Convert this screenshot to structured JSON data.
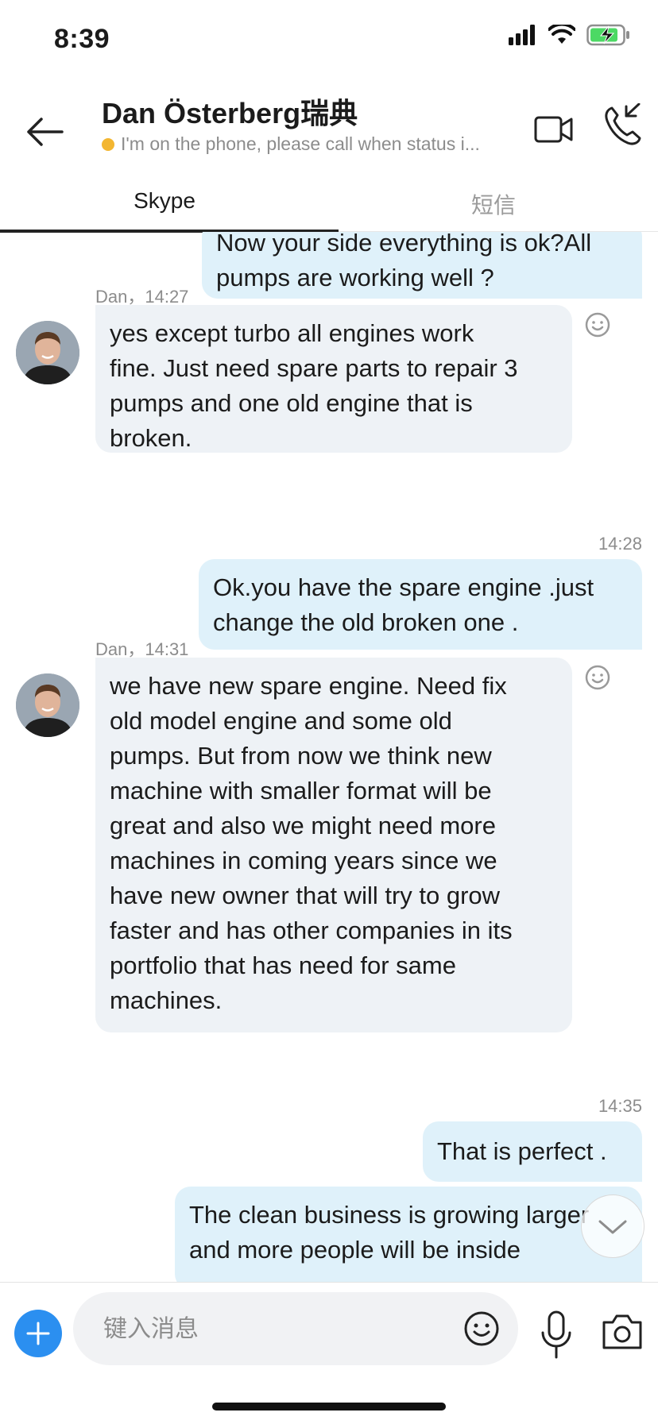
{
  "status_bar": {
    "time": "8:39"
  },
  "header": {
    "contact_name": "Dan Österberg瑞典",
    "contact_status": "I'm on the phone, please call when status i..."
  },
  "tabs": [
    {
      "label": "Skype",
      "active": true
    },
    {
      "label": "短信",
      "active": false
    }
  ],
  "messages": [
    {
      "direction": "out",
      "text_lines": [
        "Now your side everything is ok?All",
        "pumps are working well ?"
      ]
    },
    {
      "direction": "in",
      "sender_time": "Dan，14:27",
      "text_lines": [
        "yes except turbo all engines work",
        "fine. Just need spare parts to repair 3",
        "pumps and one old engine that is",
        "broken."
      ]
    },
    {
      "direction": "out",
      "time": "14:28",
      "text_lines": [
        "Ok.you have the spare engine .just",
        "change the old broken one ."
      ]
    },
    {
      "direction": "in",
      "sender_time": "Dan，14:31",
      "text_lines": [
        "we have new spare engine. Need fix",
        "old model engine and some old",
        "pumps. But from now we think new",
        "machine with smaller format will be",
        "great and also we might need more",
        "machines in coming years since we",
        "have new owner that will try to grow",
        "faster and has other companies in its",
        "portfolio that has need for same",
        "machines."
      ]
    },
    {
      "direction": "out",
      "time": "14:35",
      "text_lines": [
        "That is perfect ."
      ]
    },
    {
      "direction": "out",
      "text_lines": [
        "The clean business is growing larger",
        "and more people will be inside"
      ]
    }
  ],
  "composer": {
    "placeholder": "键入消息"
  },
  "colors": {
    "accent": "#2b8ff0",
    "outgoing_bubble": "#dff1fa",
    "incoming_bubble": "#eef2f6",
    "away_status": "#f3b631"
  }
}
